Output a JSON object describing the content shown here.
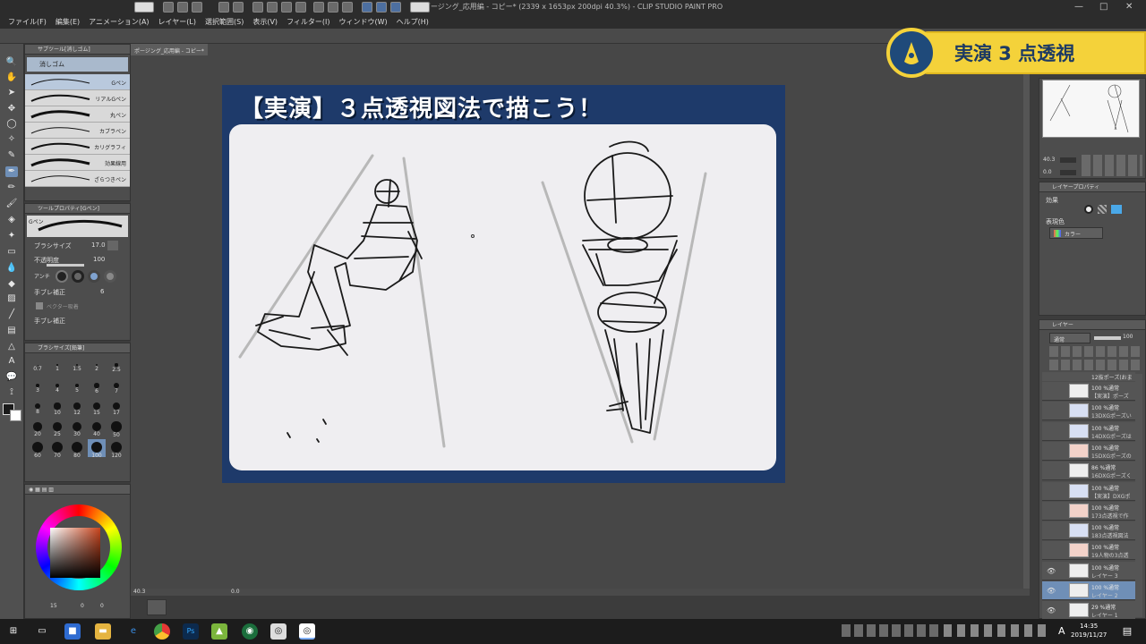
{
  "window": {
    "title": "ポージング_応用編 - コピー* (2339 x 1653px 200dpi 40.3%)  - CLIP STUDIO PAINT PRO",
    "controls": [
      "—",
      "□",
      "✕"
    ]
  },
  "menu": [
    "ファイル(F)",
    "編集(E)",
    "アニメーション(A)",
    "レイヤー(L)",
    "選択範囲(S)",
    "表示(V)",
    "フィルター(I)",
    "ウィンドウ(W)",
    "ヘルプ(H)"
  ],
  "subtool": {
    "panel_title": "サブツール[消しゴム]",
    "group": "消しゴム",
    "brushes": [
      "Gペン",
      "リアルGペン",
      "丸ペン",
      "カブラペン",
      "カリグラフィ",
      "効果線用",
      "ざらつきペン"
    ],
    "selected_brush": 0
  },
  "tool_property": {
    "panel_title": "ツールプロパティ[Gペン]",
    "brush_name": "Gペン",
    "brush_size_label": "ブラシサイズ",
    "brush_size_value": "17.0",
    "opacity_label": "不透明度",
    "opacity_value": "100",
    "antialias_label": "アンチ",
    "stabilization_label": "手ブレ補正",
    "stabilization_value": "6",
    "vector_label": "ベクター吸着",
    "stabilization2_label": "手ブレ補正"
  },
  "brush_size_panel": {
    "panel_title": "ブラシサイズ[鉛筆]",
    "sizes": [
      "0.7",
      "1",
      "1.5",
      "2",
      "2.5",
      "3",
      "4",
      "5",
      "6",
      "7",
      "8",
      "10",
      "12",
      "15",
      "17",
      "20",
      "25",
      "30",
      "40",
      "50",
      "60",
      "70",
      "80",
      "100",
      "120"
    ],
    "selected_size": "100"
  },
  "color_panel": {
    "accent": "#c8451e",
    "values": [
      "15",
      "0",
      "0"
    ]
  },
  "document": {
    "tab_label": "ポージング_応用編 - コピー*",
    "slide_title": "【実演】３点透視図法で描こう！",
    "slide_bg": "#1e3a6a"
  },
  "banner": {
    "text": "実演 3 点透視",
    "bg": "#f4d23a"
  },
  "status": {
    "zoom": "40.3",
    "angle": "0.0"
  },
  "navigator": {
    "zoom": "40.3",
    "angle": "0.0"
  },
  "layer_property": {
    "panel_title": "レイヤープロパティ",
    "effect_label": "効果",
    "display_color_label": "表現色",
    "display_color_value": "カラー"
  },
  "layers_panel": {
    "panel_title": "レイヤー",
    "blend_mode": "通常",
    "opacity": "100",
    "partial_top": "12抜ポーズ(おま",
    "layers": [
      {
        "line1": "100 %通常",
        "line2": "【実演】ポーズ",
        "thumb": "plain",
        "eye": false
      },
      {
        "line1": "100 %通常",
        "line2": "13DXGポーズい",
        "thumb": "blue",
        "eye": false
      },
      {
        "line1": "100 %通常",
        "line2": "14DXGポーズは",
        "thumb": "blue",
        "eye": false
      },
      {
        "line1": "100 %通常",
        "line2": "15DXGポーズの",
        "thumb": "red",
        "eye": false
      },
      {
        "line1": "86 %通常",
        "line2": "16DXGポーズく",
        "thumb": "plain",
        "eye": false
      },
      {
        "line1": "100 %通常",
        "line2": "【実演】DXGポ",
        "thumb": "blue",
        "eye": false
      },
      {
        "line1": "100 %通常",
        "line2": "173点透視で作",
        "thumb": "red",
        "eye": false
      },
      {
        "line1": "100 %通常",
        "line2": "183点透視図法",
        "thumb": "blue",
        "eye": false
      },
      {
        "line1": "100 %通常",
        "line2": "19人物の3点透",
        "thumb": "red",
        "eye": false
      },
      {
        "line1": "100 %通常",
        "line2": "レイヤー 3",
        "thumb": "plain",
        "eye": true
      },
      {
        "line1": "100 %通常",
        "line2": "レイヤー 2",
        "thumb": "plain",
        "eye": true,
        "selected": true
      },
      {
        "line1": "29 %通常",
        "line2": "レイヤー 1",
        "thumb": "plain",
        "eye": true
      }
    ]
  },
  "taskbar": {
    "time": "14:35",
    "date": "2019/11/27",
    "ime": "A"
  }
}
